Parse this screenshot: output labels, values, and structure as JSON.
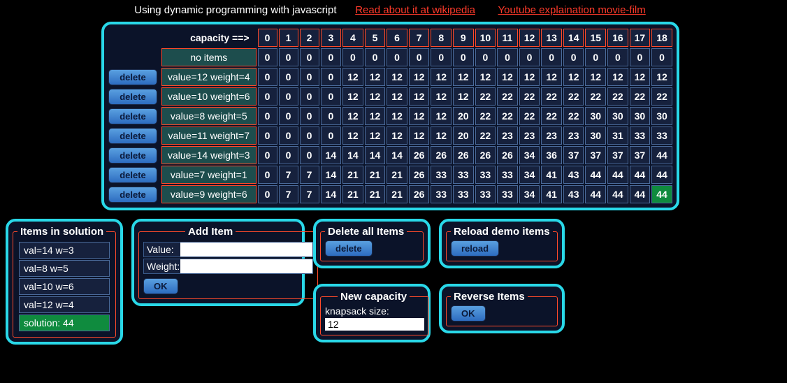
{
  "header": {
    "title": "Using dynamic programming with javascript",
    "link1": "Read about it at wikipedia",
    "link2": "Youtube explaination movie-film"
  },
  "dp": {
    "cap_label": "capacity ==>",
    "capacities": [
      "0",
      "1",
      "2",
      "3",
      "4",
      "5",
      "6",
      "7",
      "8",
      "9",
      "10",
      "11",
      "12",
      "13",
      "14",
      "15",
      "16",
      "17",
      "18"
    ],
    "rows": [
      {
        "label": "no items",
        "delete": false,
        "cells": [
          "0",
          "0",
          "0",
          "0",
          "0",
          "0",
          "0",
          "0",
          "0",
          "0",
          "0",
          "0",
          "0",
          "0",
          "0",
          "0",
          "0",
          "0",
          "0"
        ]
      },
      {
        "label": "value=12 weight=4",
        "delete": true,
        "cells": [
          "0",
          "0",
          "0",
          "0",
          "12",
          "12",
          "12",
          "12",
          "12",
          "12",
          "12",
          "12",
          "12",
          "12",
          "12",
          "12",
          "12",
          "12",
          "12"
        ]
      },
      {
        "label": "value=10 weight=6",
        "delete": true,
        "cells": [
          "0",
          "0",
          "0",
          "0",
          "12",
          "12",
          "12",
          "12",
          "12",
          "12",
          "22",
          "22",
          "22",
          "22",
          "22",
          "22",
          "22",
          "22",
          "22"
        ]
      },
      {
        "label": "value=8 weight=5",
        "delete": true,
        "cells": [
          "0",
          "0",
          "0",
          "0",
          "12",
          "12",
          "12",
          "12",
          "12",
          "20",
          "22",
          "22",
          "22",
          "22",
          "22",
          "30",
          "30",
          "30",
          "30"
        ]
      },
      {
        "label": "value=11 weight=7",
        "delete": true,
        "cells": [
          "0",
          "0",
          "0",
          "0",
          "12",
          "12",
          "12",
          "12",
          "12",
          "20",
          "22",
          "23",
          "23",
          "23",
          "23",
          "30",
          "31",
          "33",
          "33"
        ]
      },
      {
        "label": "value=14 weight=3",
        "delete": true,
        "cells": [
          "0",
          "0",
          "0",
          "14",
          "14",
          "14",
          "14",
          "26",
          "26",
          "26",
          "26",
          "26",
          "34",
          "36",
          "37",
          "37",
          "37",
          "37",
          "44"
        ]
      },
      {
        "label": "value=7 weight=1",
        "delete": true,
        "cells": [
          "0",
          "7",
          "7",
          "14",
          "21",
          "21",
          "21",
          "26",
          "33",
          "33",
          "33",
          "33",
          "34",
          "41",
          "43",
          "44",
          "44",
          "44",
          "44"
        ]
      },
      {
        "label": "value=9 weight=6",
        "delete": true,
        "cells": [
          "0",
          "7",
          "7",
          "14",
          "21",
          "21",
          "21",
          "26",
          "33",
          "33",
          "33",
          "33",
          "34",
          "41",
          "43",
          "44",
          "44",
          "44",
          "44"
        ],
        "solution_index": 18
      }
    ],
    "delete_label": "delete"
  },
  "solution": {
    "legend": "Items in solution",
    "items": [
      "val=14 w=3",
      "val=8 w=5",
      "val=10 w=6",
      "val=12 w=4"
    ],
    "final": "solution: 44"
  },
  "add_item": {
    "legend": "Add Item",
    "value_label": "Value:",
    "weight_label": "Weight:",
    "ok": "OK"
  },
  "delete_all": {
    "legend": "Delete all Items",
    "button": "delete"
  },
  "reload": {
    "legend": "Reload demo items",
    "button": "reload"
  },
  "new_cap": {
    "legend": "New capacity",
    "label": "knapsack size:",
    "value": "12"
  },
  "reverse": {
    "legend": "Reverse Items",
    "button": "OK"
  }
}
